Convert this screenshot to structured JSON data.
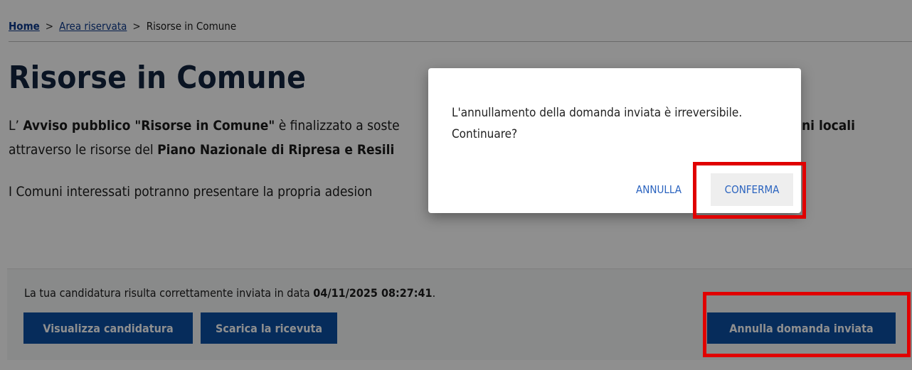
{
  "breadcrumb": {
    "home": "Home",
    "separator": ">",
    "area": "Area riservata",
    "current": "Risorse in Comune"
  },
  "page_title": "Risorse in Comune",
  "intro": {
    "part1": "L’ ",
    "bold1": "Avviso pubblico \"Risorse in Comune\"",
    "part2": " è finalizzato a soste",
    "bold_tail": "ni locali",
    "line2_part1": "attraverso le risorse del ",
    "line2_bold": "Piano Nazionale di Ripresa e Resili"
  },
  "intro2": "I Comuni interessati potranno presentare la propria adesion",
  "card": {
    "status_prefix": "La tua candidatura risulta correttamente inviata in data ",
    "status_date": "04/11/2025 08:27:41",
    "status_suffix": ".",
    "view_button": "Visualizza candidatura",
    "receipt_button": "Scarica la ricevuta",
    "cancel_button": "Annulla domanda inviata"
  },
  "dialog": {
    "message_line1": "L'annullamento della domanda inviata è irreversibile.",
    "message_line2": "Continuare?",
    "cancel_label": "ANNULLA",
    "confirm_label": "CONFERMA"
  },
  "colors": {
    "primary": "#0b4fa3",
    "highlight": "#e00000",
    "title": "#13253f",
    "link": "#0d3a8c"
  }
}
